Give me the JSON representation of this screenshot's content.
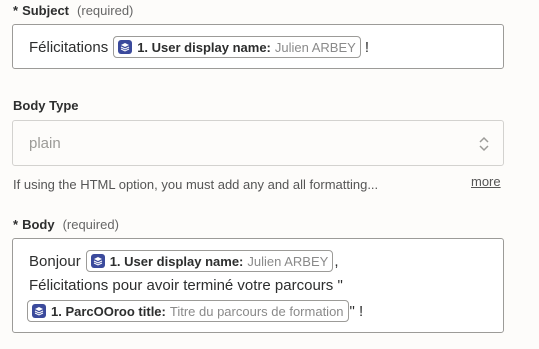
{
  "subject": {
    "label": "Subject",
    "required": "(required)",
    "prefix_text": "Félicitations",
    "pill": {
      "key": "1. User display name:",
      "value": "Julien ARBEY"
    },
    "suffix_text": "!"
  },
  "body_type": {
    "label": "Body Type",
    "value": "plain",
    "hint": "If using the HTML option, you must add any and all formatting...",
    "more_label": "more"
  },
  "body": {
    "label": "Body",
    "required": "(required)",
    "line1_prefix": "Bonjour",
    "line1_pill": {
      "key": "1. User display name:",
      "value": "Julien ARBEY"
    },
    "line1_suffix": ",",
    "line2": "Félicitations pour avoir terminé votre parcours \"",
    "line3_pill": {
      "key": "1. ParcOOroo title:",
      "value": "Titre du parcours de formation"
    },
    "line3_suffix": "\" !"
  },
  "colors": {
    "app_icon": "#3b4a9c",
    "border": "#9c9b98",
    "placeholder": "#9c9b98"
  },
  "icons": {
    "app": "stack-app-icon",
    "select": "chevron-up-down-icon"
  }
}
